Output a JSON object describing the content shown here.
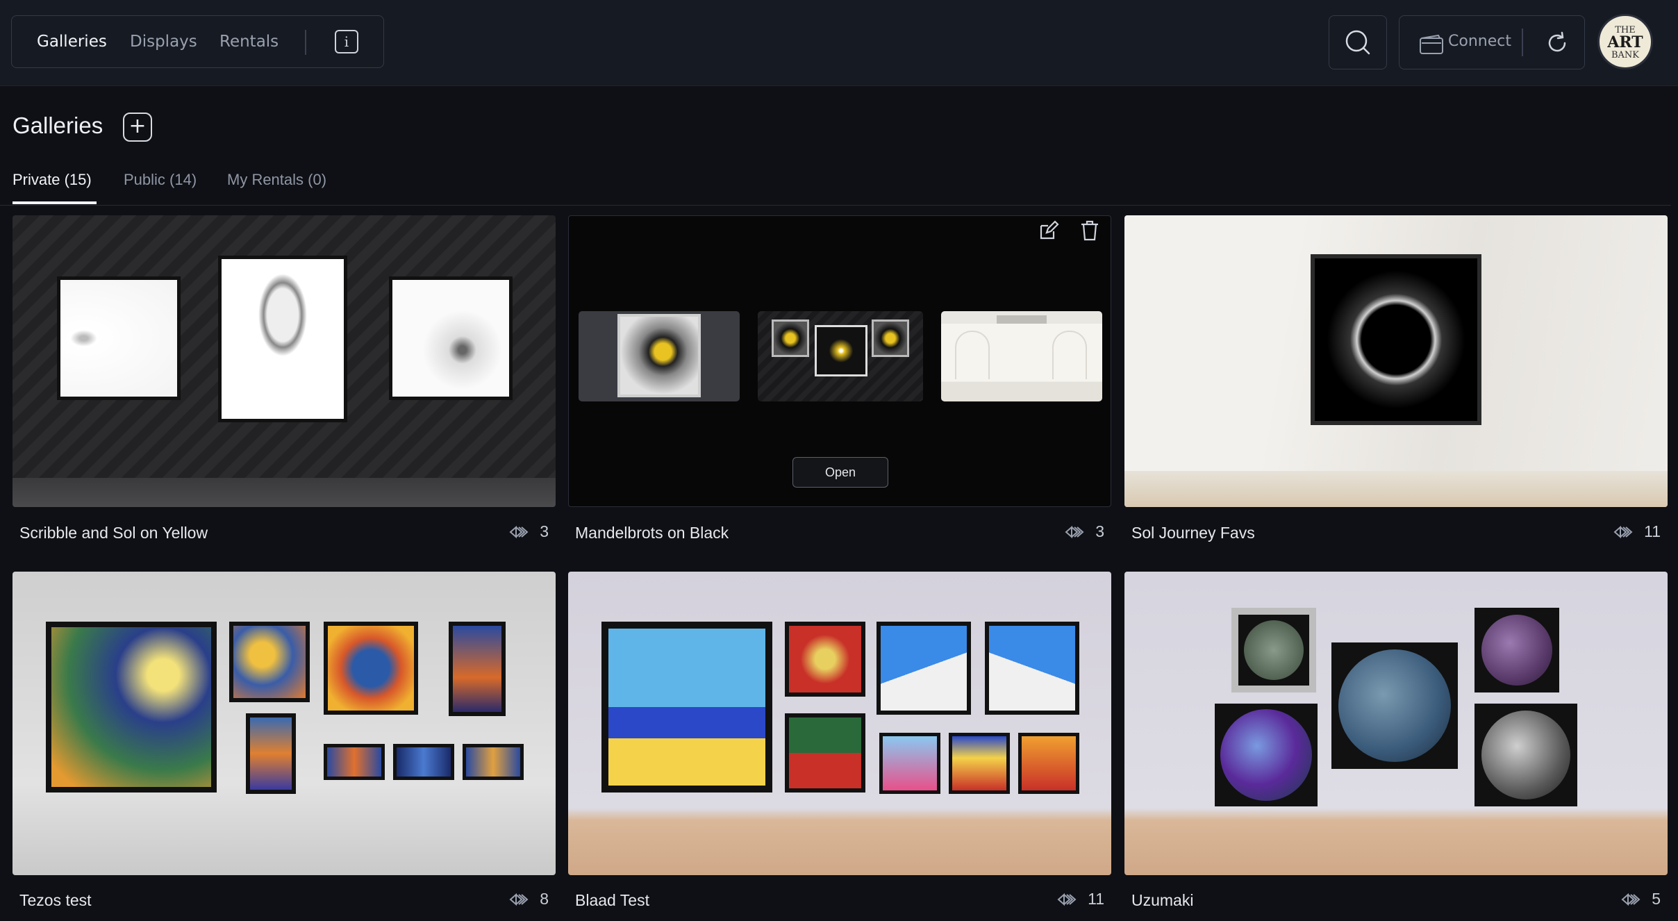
{
  "nav": {
    "items": [
      {
        "label": "Galleries",
        "active": true
      },
      {
        "label": "Displays",
        "active": false
      },
      {
        "label": "Rentals",
        "active": false
      }
    ],
    "info_icon": "info-icon"
  },
  "header": {
    "search_icon": "search-icon",
    "connect_label": "Connect",
    "wallet_icon": "wallet-icon",
    "refresh_icon": "refresh-icon",
    "avatar_text": [
      "THE",
      "ART",
      "BANK"
    ]
  },
  "page": {
    "title": "Galleries",
    "add_icon": "plus-icon",
    "tabs": [
      {
        "label": "Private (15)",
        "active": true
      },
      {
        "label": "Public (14)",
        "active": false
      },
      {
        "label": "My Rentals (0)",
        "active": false
      }
    ]
  },
  "galleries": [
    {
      "name": "Scribble and Sol on Yellow",
      "count": "3"
    },
    {
      "name": "Mandelbrots on Black",
      "count": "3",
      "open_label": "Open",
      "hovered": true
    },
    {
      "name": "Sol Journey Favs",
      "count": "11"
    },
    {
      "name": "Tezos test",
      "count": "8"
    },
    {
      "name": "Blaad Test",
      "count": "11"
    },
    {
      "name": "Uzumaki",
      "count": "5"
    }
  ],
  "colors": {
    "background": "#0e1015",
    "topbar": "#161a22",
    "border": "#343a48",
    "text": "#e6e8ee",
    "muted": "#9aa1af"
  }
}
